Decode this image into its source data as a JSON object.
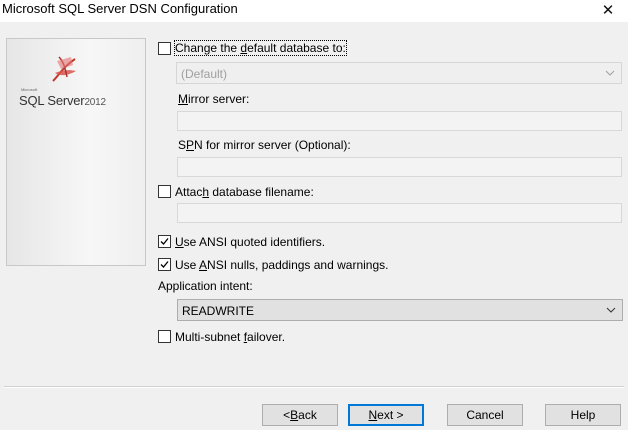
{
  "window": {
    "title": "Microsoft SQL Server DSN Configuration",
    "close_glyph": "✕"
  },
  "logo": {
    "small_text": "Microsoft",
    "product": "SQL Server",
    "version": "2012"
  },
  "options": {
    "change_db": {
      "label_pre": "Change the ",
      "label_ul": "d",
      "label_post": "efault database to:",
      "checked": false
    },
    "database_combo": {
      "value": "(Default)"
    },
    "mirror": {
      "label_ul": "M",
      "label_post": "irror server:",
      "value": ""
    },
    "spn": {
      "label_pre": "S",
      "label_ul": "P",
      "label_post": "N for mirror server (Optional):",
      "value": ""
    },
    "attach": {
      "label_pre": "Attac",
      "label_ul": "h",
      "label_post": " database filename:",
      "checked": false,
      "value": ""
    },
    "ansi_quoted": {
      "label_ul": "U",
      "label_post": "se ANSI quoted identifiers.",
      "checked": true
    },
    "ansi_nulls": {
      "label_pre": "Use ",
      "label_ul": "A",
      "label_post": "NSI nulls, paddings and warnings.",
      "checked": true
    },
    "app_intent": {
      "label": "Application intent:",
      "value": "READWRITE"
    },
    "multisubnet": {
      "label_pre": "Multi-subnet ",
      "label_ul": "f",
      "label_post": "ailover.",
      "checked": false
    }
  },
  "buttons": {
    "back": {
      "prefix": "< ",
      "ul": "B",
      "rest": "ack"
    },
    "next": {
      "ul": "N",
      "rest": "ext >"
    },
    "cancel": {
      "label": "Cancel"
    },
    "help": {
      "label": "Help"
    }
  },
  "colors": {
    "accent": "#0078d7",
    "logo_red": "#c0392b"
  }
}
